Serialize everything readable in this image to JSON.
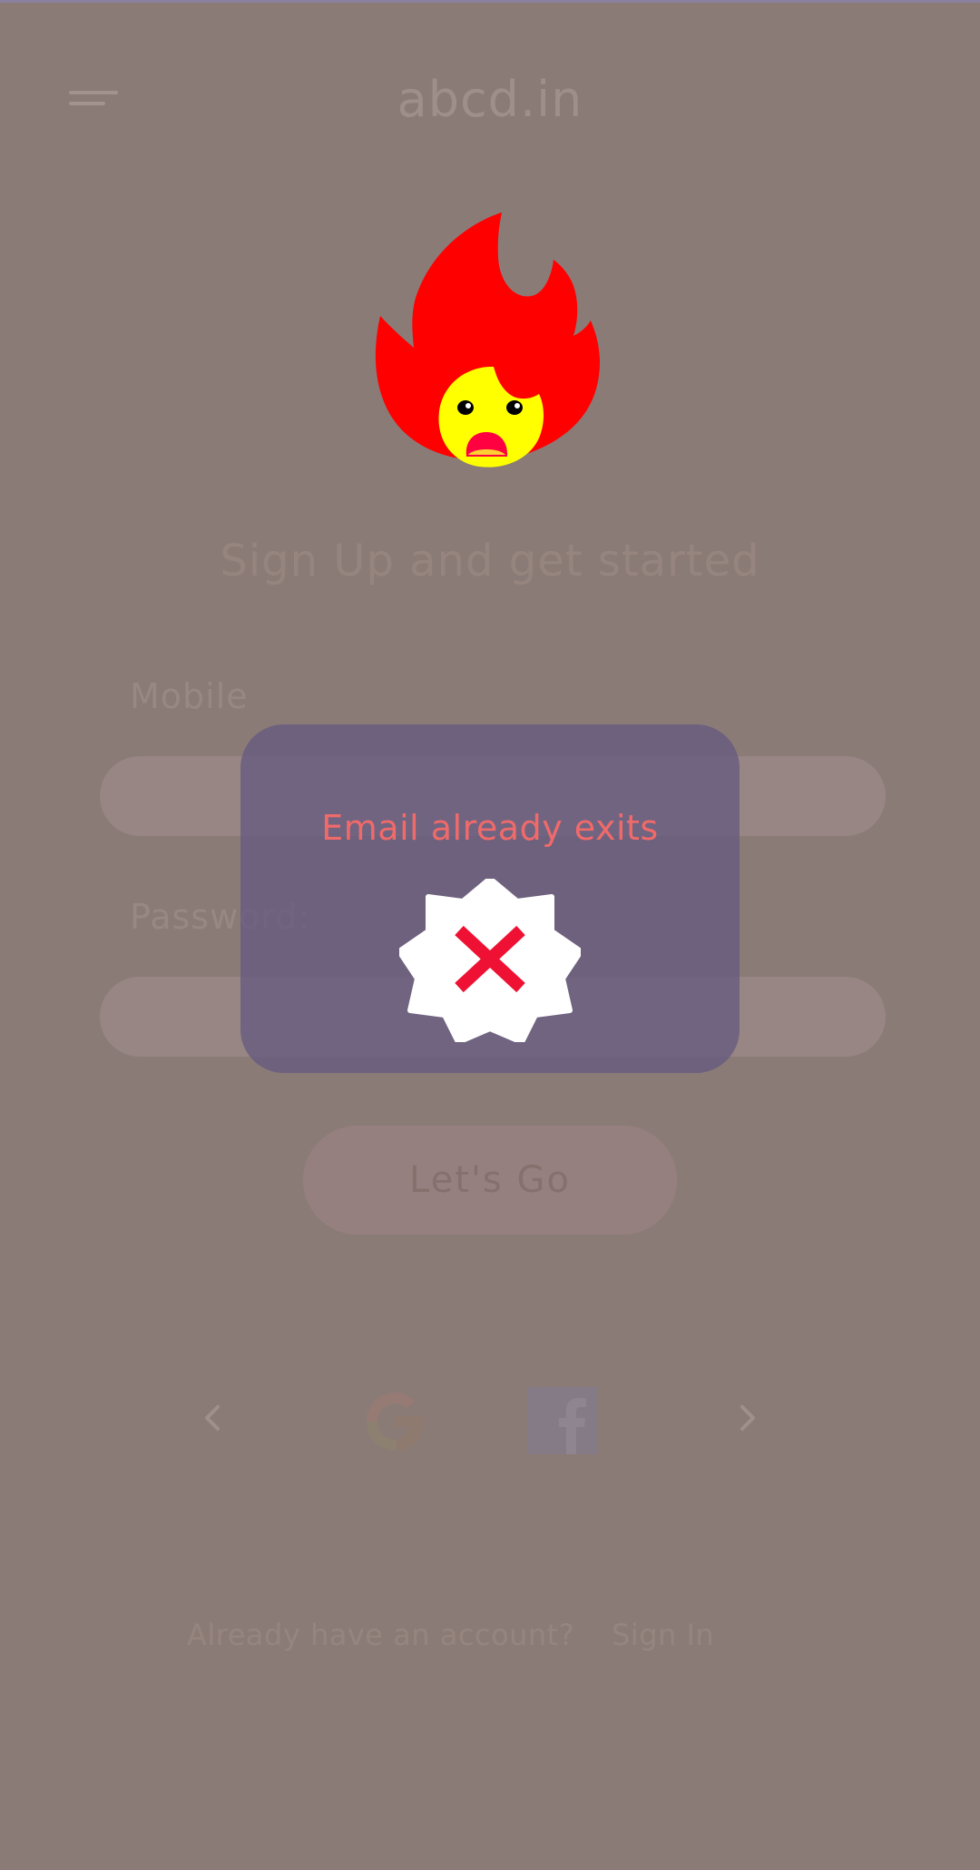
{
  "header": {
    "title": "abcd.in",
    "menu_icon": "hamburger-menu-icon"
  },
  "logo": {
    "icon": "fire-mascot-icon"
  },
  "signup": {
    "heading": "Sign Up and get started",
    "mobile_label": "Mobile",
    "mobile_value": "",
    "password_label": "Password:",
    "password_value": "",
    "submit_label": "Let's Go"
  },
  "social": {
    "prev_icon": "chevron-left-icon",
    "next_icon": "chevron-right-icon",
    "providers": [
      "google-icon",
      "facebook-icon"
    ]
  },
  "footer": {
    "question": "Already have an account?",
    "signin_label": "Sign In"
  },
  "dialog": {
    "message": "Email already exits",
    "icon": "error-badge-icon",
    "message_color": "#f06a6a"
  },
  "colors": {
    "overlay_background": "#8b7b77",
    "dialog_background": "#6a5d80",
    "flame_red": "#ff0000",
    "flame_yellow": "#ffff00"
  }
}
